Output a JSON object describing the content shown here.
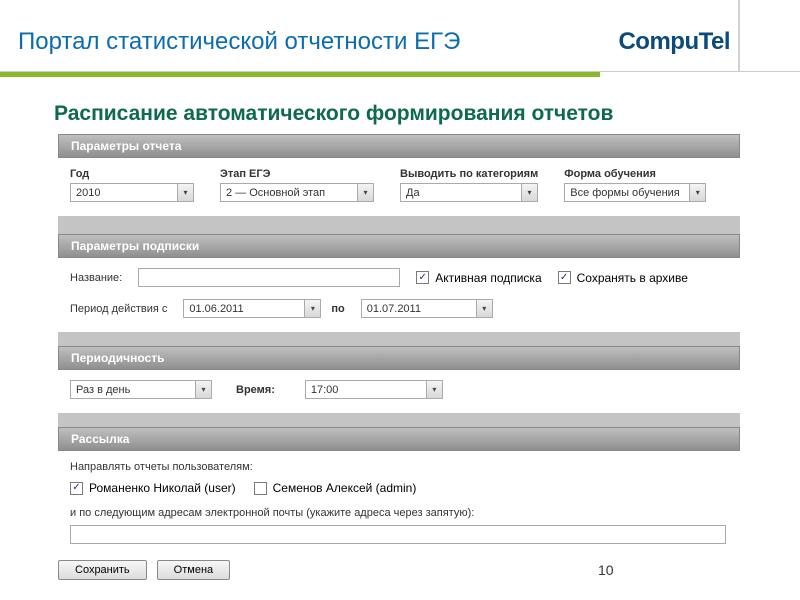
{
  "header": {
    "title": "Портал статистической отчетности ЕГЭ",
    "logo_text": "CompuTel"
  },
  "section_title": "Расписание автоматического формирования отчетов",
  "groups": {
    "report_params": {
      "header": "Параметры отчета",
      "year_label": "Год",
      "year_value": "2010",
      "stage_label": "Этап ЕГЭ",
      "stage_value": "2 — Основной этап",
      "by_category_label": "Выводить по категориям",
      "by_category_value": "Да",
      "study_form_label": "Форма обучения",
      "study_form_value": "Все формы обучения"
    },
    "subscription": {
      "header": "Параметры подписки",
      "name_label": "Название:",
      "name_value": "",
      "active_label": "Активная подписка",
      "archive_label": "Сохранять в архиве",
      "period_label": "Период действия с",
      "date_from": "01.06.2011",
      "date_to_label": "по",
      "date_to": "01.07.2011"
    },
    "periodicity": {
      "header": "Периодичность",
      "freq_value": "Раз в день",
      "time_label": "Время:",
      "time_value": "17:00"
    },
    "mailing": {
      "header": "Рассылка",
      "users_label": "Направлять отчеты пользователям:",
      "user1": "Романенко Николай (user)",
      "user2": "Семенов Алексей (admin)",
      "emails_label": "и по следующим адресам электронной почты (укажите адреса через запятую):",
      "emails_value": ""
    }
  },
  "buttons": {
    "save": "Сохранить",
    "cancel": "Отмена"
  },
  "page_number": "10"
}
